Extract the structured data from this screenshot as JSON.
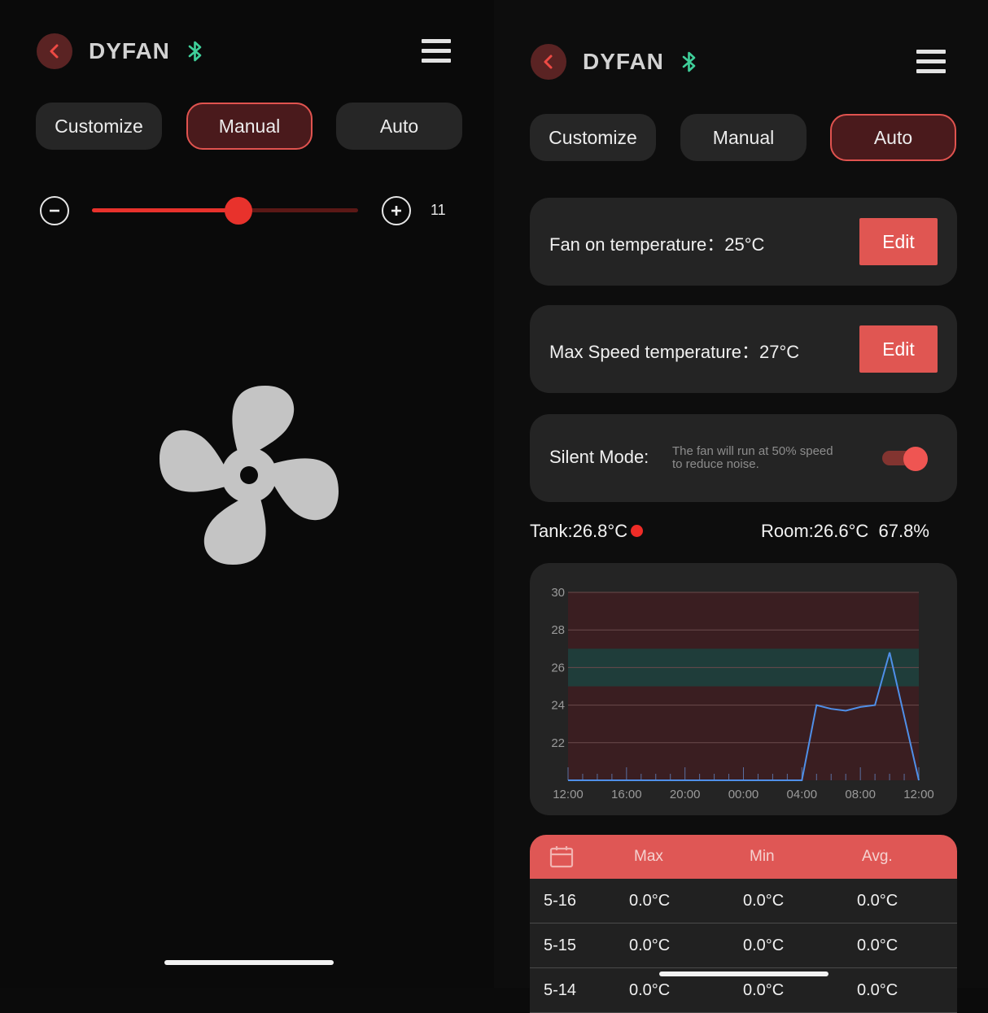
{
  "left": {
    "header": {
      "title": "DYFAN",
      "icons": [
        "back-chevron-icon",
        "bluetooth-icon",
        "hamburger-menu-icon"
      ]
    },
    "tabs": [
      {
        "label": "Customize",
        "active": false
      },
      {
        "label": "Manual",
        "active": true
      },
      {
        "label": "Auto",
        "active": false
      }
    ],
    "speed": {
      "value": "11",
      "level_fraction": 0.55
    },
    "fan_icon": "fan-icon"
  },
  "right": {
    "header": {
      "title": "DYFAN",
      "icons": [
        "back-chevron-icon",
        "bluetooth-icon",
        "hamburger-menu-icon"
      ]
    },
    "tabs": [
      {
        "label": "Customize",
        "active": false
      },
      {
        "label": "Manual",
        "active": false
      },
      {
        "label": "Auto",
        "active": true
      }
    ],
    "fan_on": {
      "label": "Fan on temperature：25°C",
      "edit_label": "Edit"
    },
    "max_speed": {
      "label": "Max Speed temperature：27°C",
      "edit_label": "Edit"
    },
    "silent": {
      "label": "Silent Mode:",
      "description": "The fan will run at 50% speed to reduce noise.",
      "enabled": true
    },
    "tank": "Tank:26.8°C",
    "room": "Room:26.6°C  67.8%",
    "table": {
      "headers": [
        "Max",
        "Min",
        "Avg."
      ],
      "rows": [
        {
          "date": "5-16",
          "max": "0.0°C",
          "min": "0.0°C",
          "avg": "0.0°C"
        },
        {
          "date": "5-15",
          "max": "0.0°C",
          "min": "0.0°C",
          "avg": "0.0°C"
        },
        {
          "date": "5-14",
          "max": "0.0°C",
          "min": "0.0°C",
          "avg": "0.0°C"
        }
      ]
    }
  },
  "colors": {
    "accent": "#e0534f",
    "active_tab_bg": "#4a1a1c",
    "card_bg": "#242424",
    "line": "#4f8fe8",
    "band": "#1f3d3a",
    "plot_bg": "#3a1e21"
  },
  "chart_data": {
    "type": "line",
    "title": "",
    "xlabel": "",
    "ylabel": "",
    "x_ticks": [
      "12:00",
      "16:00",
      "20:00",
      "00:00",
      "04:00",
      "08:00",
      "12:00"
    ],
    "y_ticks": [
      "22",
      "24",
      "26",
      "28",
      "30"
    ],
    "ylim": [
      20,
      30
    ],
    "band": [
      25,
      27
    ],
    "grid": true,
    "series": [
      {
        "values": [
          [
            0,
            20
          ],
          [
            16,
            20
          ],
          [
            17,
            24
          ],
          [
            18,
            23.8
          ],
          [
            19,
            23.7
          ],
          [
            20,
            23.9
          ],
          [
            21,
            24
          ],
          [
            22,
            26.8
          ],
          [
            24,
            20
          ]
        ]
      }
    ]
  }
}
